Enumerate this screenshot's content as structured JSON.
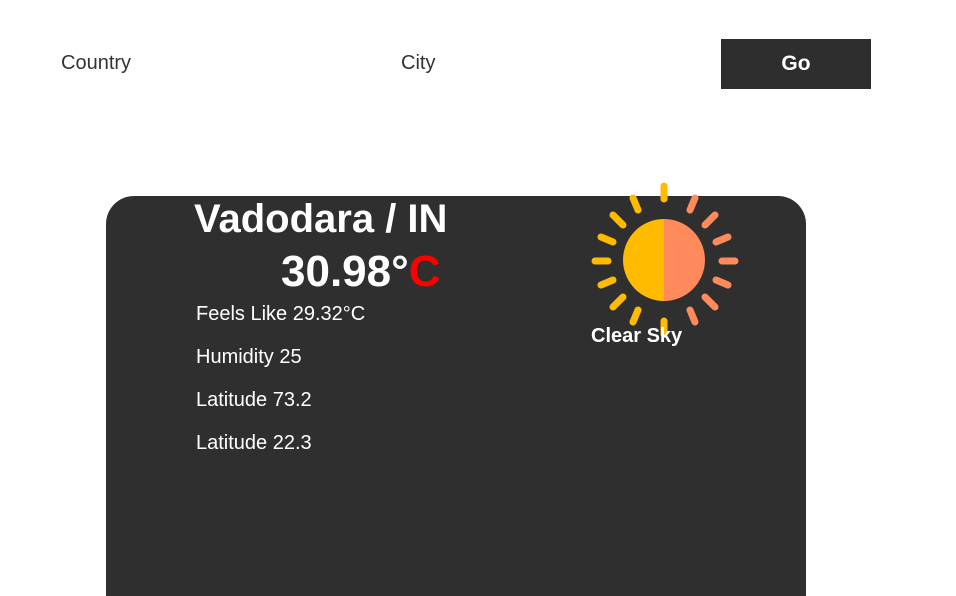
{
  "search": {
    "country_placeholder": "Country",
    "city_placeholder": "City",
    "go_label": "Go"
  },
  "weather": {
    "location": "Vadodara / IN",
    "temperature": "30.98°",
    "temperature_unit": "C",
    "feels_like": "Feels Like 29.32°C",
    "humidity": "Humidity 25",
    "latitude_1": "Latitude 73.2",
    "latitude_2": "Latitude 22.3",
    "condition": "Clear Sky",
    "condition_icon": "sun-icon"
  },
  "colors": {
    "card_background": "#2f2f2f",
    "button_background": "#2e2e2e",
    "unit_red": "#ff0000",
    "sun_yellow": "#ffbb00",
    "sun_orange": "#ff8a5c"
  }
}
